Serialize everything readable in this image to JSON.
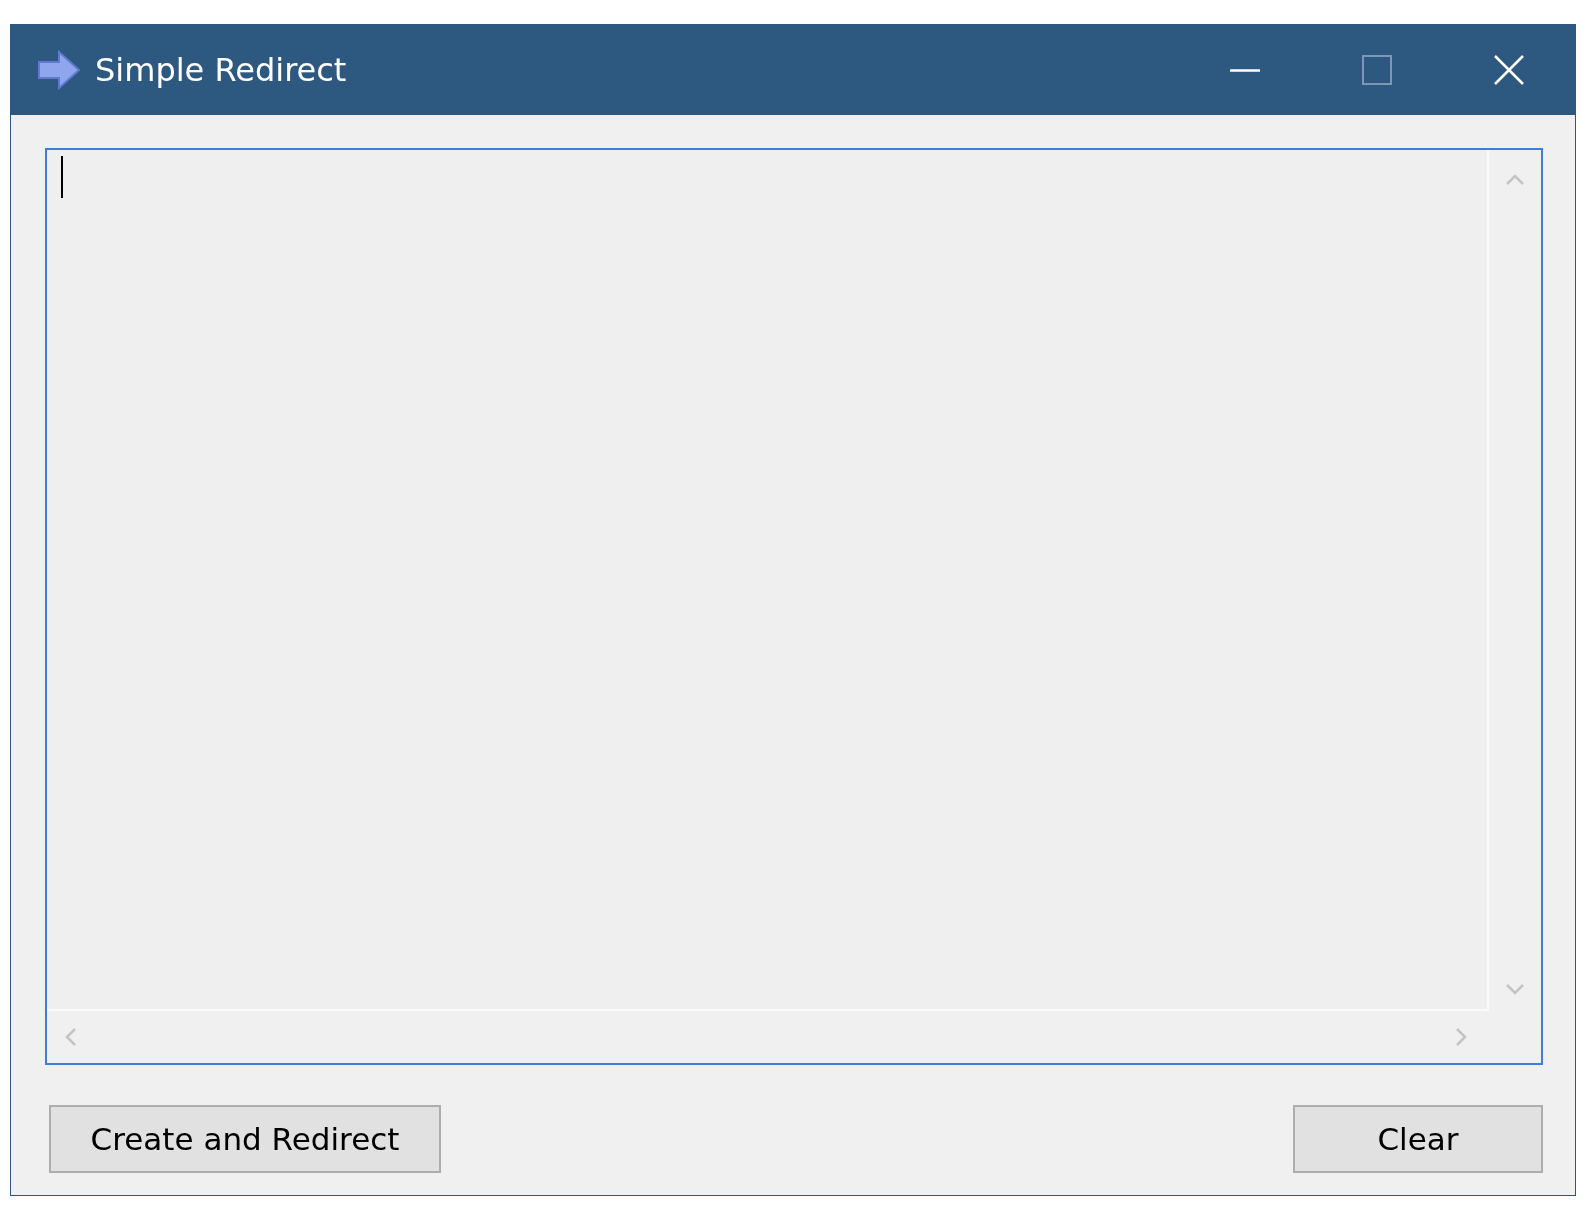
{
  "window": {
    "title": "Simple Redirect"
  },
  "text_area": {
    "focused": true
  },
  "buttons": [
    {
      "label": "Create and Redirect"
    },
    {
      "label": "Clear"
    }
  ]
}
